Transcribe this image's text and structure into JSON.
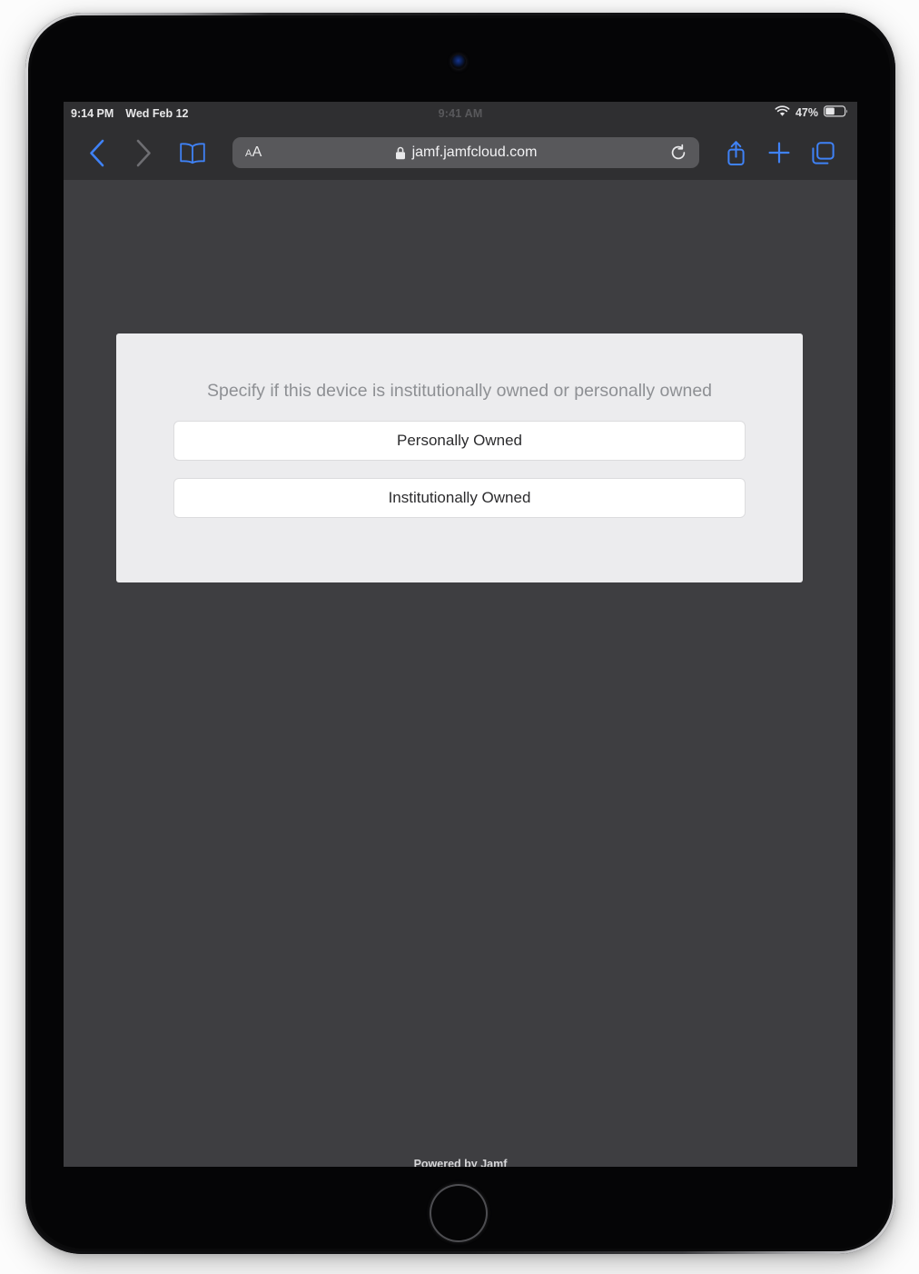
{
  "status_bar": {
    "time": "9:14 PM",
    "date": "Wed Feb 12",
    "center_time_ghost": "9:41 AM",
    "battery_percent": "47%",
    "wifi_icon": "wifi-icon",
    "battery_icon": "battery-icon"
  },
  "browser": {
    "back_icon": "chevron-left-icon",
    "forward_icon": "chevron-right-icon",
    "bookmarks_icon": "book-icon",
    "text_size_small": "A",
    "text_size_large": "A",
    "lock_icon": "lock-icon",
    "url": "jamf.jamfcloud.com",
    "reload_icon": "reload-icon",
    "share_icon": "share-icon",
    "new_tab_icon": "plus-icon",
    "tabs_icon": "tabs-icon",
    "accent_color": "#3f82f7",
    "toolbar_color": "#2f2f31",
    "urlbar_color": "#58585b"
  },
  "page": {
    "background_color": "#3e3e41",
    "card": {
      "background_color": "#ececee",
      "prompt": "Specify if this device is institutionally owned or personally owned",
      "prompt_color": "#8e9094",
      "buttons": [
        {
          "label": "Personally Owned"
        },
        {
          "label": "Institutionally Owned"
        }
      ]
    },
    "footer": "Powered by Jamf"
  }
}
